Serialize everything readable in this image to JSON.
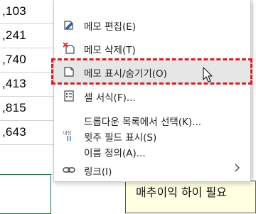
{
  "sheet": {
    "cell_values": [
      ",103",
      ",241",
      ",740",
      ",413",
      ",815",
      ",643"
    ],
    "note_text": "매추이익 하이 필요"
  },
  "context_menu": {
    "items": [
      {
        "label": "메모 편집(E)",
        "icon": "edit-note-icon"
      },
      {
        "label": "메모 삭제(T)",
        "icon": "delete-note-icon"
      },
      {
        "label": "메모 표시/숨기기(O)",
        "icon": "show-hide-note-icon",
        "highlighted": true
      },
      {
        "label": "셀 서식(F)...",
        "icon": "format-cells-icon"
      },
      {
        "label": "드롭다운 목록에서 선택(K)...",
        "icon": ""
      },
      {
        "label": "윗주 필드 표시(S)",
        "icon": "phonetic-guide-icon",
        "icon_text": "내천"
      },
      {
        "label": "이름 정의(A)...",
        "icon": ""
      },
      {
        "label": "링크(I)",
        "icon": "link-icon",
        "has_submenu": true
      }
    ]
  },
  "colors": {
    "highlight_border": "#d4202a",
    "hover_bg": "#e6e6e6",
    "note_bg": "#ffffe1",
    "active_cell_border": "#217346"
  }
}
